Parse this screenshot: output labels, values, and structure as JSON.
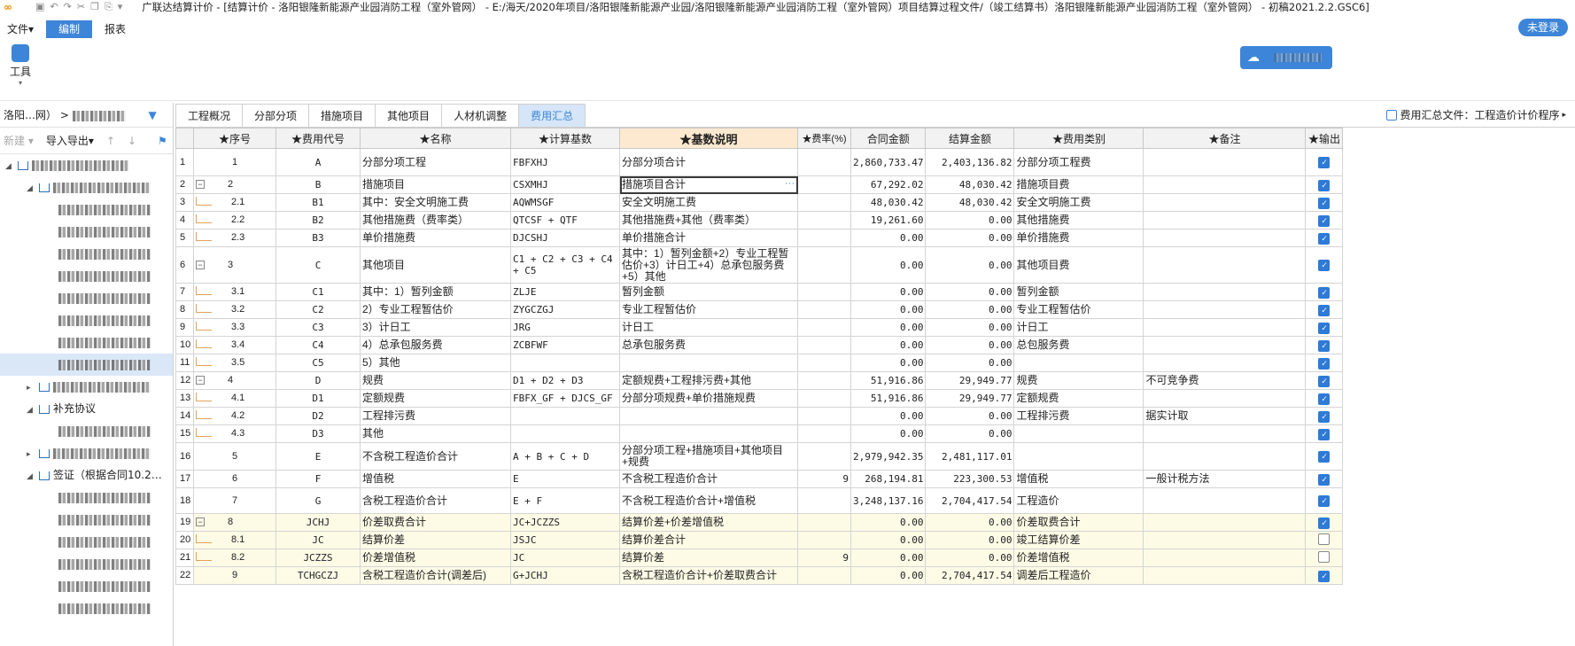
{
  "window": {
    "title": "广联达结算计价 - [结算计价 - 洛阳银隆新能源产业园消防工程（室外管网） - E:/海天/2020年项目/洛阳银隆新能源产业园/洛阳银隆新能源产业园消防工程（室外管网）项目结算过程文件/（竣工结算书）洛阳银隆新能源产业园消防工程（室外管网） - 初稿2021.2.2.GSC6]"
  },
  "menu": {
    "file": "文件▾",
    "edit": "编制",
    "report": "报表"
  },
  "login": "未登录",
  "ribbon": {
    "tool_label": "工具"
  },
  "left_panel": {
    "path": "洛阳…网）",
    "new_label": "新建 ▾",
    "import_export_label": "导入导出▾",
    "tree_items": [
      {
        "label": "洛阳银隆新能源产业园",
        "level": 0
      },
      {
        "label": "洛阳银隆新能源",
        "level": 1
      },
      {
        "label": "洛阳",
        "level": 2
      },
      {
        "label": "洛阳",
        "level": 2
      },
      {
        "label": "洛阳",
        "level": 2
      },
      {
        "label": "洛阳",
        "level": 2
      },
      {
        "label": "洛阳",
        "level": 2
      },
      {
        "label": "洛阳",
        "level": 2
      },
      {
        "label": "洛阳",
        "level": 2
      },
      {
        "label": "洛阳",
        "level": 2
      },
      {
        "label": "洛阳",
        "level": 1
      },
      {
        "label": "补充协议",
        "level": 1
      },
      {
        "label": "洛阳",
        "level": 2
      },
      {
        "label": "签证",
        "level": 1
      },
      {
        "label": "签证（根据合同10.2…",
        "level": 1
      },
      {
        "label": "洛阳",
        "level": 2
      },
      {
        "label": "洛阳",
        "level": 2
      },
      {
        "label": "洛阳",
        "level": 2
      },
      {
        "label": "洛阳",
        "level": 2
      },
      {
        "label": "洛阳",
        "level": 2
      },
      {
        "label": "洛阳",
        "level": 2
      }
    ]
  },
  "tabs": [
    "工程概况",
    "分部分项",
    "措施项目",
    "其他项目",
    "人材机调整",
    "费用汇总"
  ],
  "tab_right": "费用汇总文件：工程造价计价程序",
  "table": {
    "headers": [
      "",
      "★序号",
      "★费用代号",
      "★名称",
      "★计算基数",
      "★基数说明",
      "★费率(%)",
      "合同金额",
      "结算金额",
      "★费用类别",
      "★备注",
      "★输出"
    ],
    "rows": [
      {
        "n": "1",
        "seq": "1",
        "code": "A",
        "name": "分部分项工程",
        "base": "FBFXHJ",
        "desc": "分部分项合计",
        "rate": "",
        "contract": "2,860,733.47",
        "settle": "2,403,136.82",
        "cat": "分部分项工程费",
        "note": "",
        "out": true,
        "h": 31,
        "lvl": 0
      },
      {
        "n": "2",
        "seq": "2",
        "code": "B",
        "name": "措施项目",
        "base": "CSXMHJ",
        "desc": "措施项目合计",
        "rate": "",
        "contract": "67,292.02",
        "settle": "48,030.42",
        "cat": "措施项目费",
        "note": "",
        "out": true,
        "h": 20,
        "lvl": 0,
        "group": true,
        "editing": true
      },
      {
        "n": "3",
        "seq": "2.1",
        "code": "B1",
        "name": "其中：安全文明施工费",
        "base": "AQWMSGF",
        "desc": "安全文明施工费",
        "rate": "",
        "contract": "48,030.42",
        "settle": "48,030.42",
        "cat": "安全文明施工费",
        "note": "",
        "out": true,
        "h": 20,
        "lvl": 1
      },
      {
        "n": "4",
        "seq": "2.2",
        "code": "B2",
        "name": "其他措施费（费率类）",
        "base": "QTCSF + QTF",
        "desc": "其他措施费+其他（费率类）",
        "rate": "",
        "contract": "19,261.60",
        "settle": "0.00",
        "cat": "其他措施费",
        "note": "",
        "out": true,
        "h": 20,
        "lvl": 1
      },
      {
        "n": "5",
        "seq": "2.3",
        "code": "B3",
        "name": "单价措施费",
        "base": "DJCSHJ",
        "desc": "单价措施合计",
        "rate": "",
        "contract": "0.00",
        "settle": "0.00",
        "cat": "单价措施费",
        "note": "",
        "out": true,
        "h": 20,
        "lvl": 1
      },
      {
        "n": "6",
        "seq": "3",
        "code": "C",
        "name": "其他项目",
        "base": "C1 + C2 + C3 + C4 + C5",
        "desc": "其中：1）暂列金额+2）专业工程暂估价+3）计日工+4）总承包服务费+5）其他",
        "rate": "",
        "contract": "0.00",
        "settle": "0.00",
        "cat": "其他项目费",
        "note": "",
        "out": true,
        "h": 41,
        "lvl": 0,
        "group": true
      },
      {
        "n": "7",
        "seq": "3.1",
        "code": "C1",
        "name": "其中：1）暂列金额",
        "base": "ZLJE",
        "desc": "暂列金额",
        "rate": "",
        "contract": "0.00",
        "settle": "0.00",
        "cat": "暂列金额",
        "note": "",
        "out": true,
        "h": 20,
        "lvl": 1
      },
      {
        "n": "8",
        "seq": "3.2",
        "code": "C2",
        "name": "2）专业工程暂估价",
        "base": "ZYGCZGJ",
        "desc": "专业工程暂估价",
        "rate": "",
        "contract": "0.00",
        "settle": "0.00",
        "cat": "专业工程暂估价",
        "note": "",
        "out": true,
        "h": 20,
        "lvl": 1
      },
      {
        "n": "9",
        "seq": "3.3",
        "code": "C3",
        "name": "3）计日工",
        "base": "JRG",
        "desc": "计日工",
        "rate": "",
        "contract": "0.00",
        "settle": "0.00",
        "cat": "计日工",
        "note": "",
        "out": true,
        "h": 20,
        "lvl": 1
      },
      {
        "n": "10",
        "seq": "3.4",
        "code": "C4",
        "name": "4）总承包服务费",
        "base": "ZCBFWF",
        "desc": "总承包服务费",
        "rate": "",
        "contract": "0.00",
        "settle": "0.00",
        "cat": "总包服务费",
        "note": "",
        "out": true,
        "h": 20,
        "lvl": 1
      },
      {
        "n": "11",
        "seq": "3.5",
        "code": "C5",
        "name": "5）其他",
        "base": "",
        "desc": "",
        "rate": "",
        "contract": "0.00",
        "settle": "0.00",
        "cat": "",
        "note": "",
        "out": true,
        "h": 20,
        "lvl": 1
      },
      {
        "n": "12",
        "seq": "4",
        "code": "D",
        "name": "规费",
        "base": "D1 + D2 + D3",
        "desc": "定额规费+工程排污费+其他",
        "rate": "",
        "contract": "51,916.86",
        "settle": "29,949.77",
        "cat": "规费",
        "note": "不可竞争费",
        "out": true,
        "h": 20,
        "lvl": 0,
        "group": true
      },
      {
        "n": "13",
        "seq": "4.1",
        "code": "D1",
        "name": "定额规费",
        "base": "FBFX_GF + DJCS_GF",
        "desc": "分部分项规费+单价措施规费",
        "rate": "",
        "contract": "51,916.86",
        "settle": "29,949.77",
        "cat": "定额规费",
        "note": "",
        "out": true,
        "h": 20,
        "lvl": 1
      },
      {
        "n": "14",
        "seq": "4.2",
        "code": "D2",
        "name": "工程排污费",
        "base": "",
        "desc": "",
        "rate": "",
        "contract": "0.00",
        "settle": "0.00",
        "cat": "工程排污费",
        "note": "据实计取",
        "out": true,
        "h": 20,
        "lvl": 1
      },
      {
        "n": "15",
        "seq": "4.3",
        "code": "D3",
        "name": "其他",
        "base": "",
        "desc": "",
        "rate": "",
        "contract": "0.00",
        "settle": "0.00",
        "cat": "",
        "note": "",
        "out": true,
        "h": 20,
        "lvl": 1
      },
      {
        "n": "16",
        "seq": "5",
        "code": "E",
        "name": "不含税工程造价合计",
        "base": "A + B + C + D",
        "desc": "分部分项工程+措施项目+其他项目+规费",
        "rate": "",
        "contract": "2,979,942.35",
        "settle": "2,481,117.01",
        "cat": "",
        "note": "",
        "out": true,
        "h": 31,
        "lvl": 0
      },
      {
        "n": "17",
        "seq": "6",
        "code": "F",
        "name": "增值税",
        "base": "E",
        "desc": "不含税工程造价合计",
        "rate": "9",
        "contract": "268,194.81",
        "settle": "223,300.53",
        "cat": "增值税",
        "note": "一般计税方法",
        "out": true,
        "h": 20,
        "lvl": 0
      },
      {
        "n": "18",
        "seq": "7",
        "code": "G",
        "name": "含税工程造价合计",
        "base": "E + F",
        "desc": "不含税工程造价合计+增值税",
        "rate": "",
        "contract": "3,248,137.16",
        "settle": "2,704,417.54",
        "cat": "工程造价",
        "note": "",
        "out": true,
        "h": 29,
        "lvl": 0
      },
      {
        "n": "19",
        "seq": "8",
        "code": "JCHJ",
        "name": "价差取费合计",
        "base": "JC+JCZZS",
        "desc": "结算价差+价差增值税",
        "rate": "",
        "contract": "0.00",
        "settle": "0.00",
        "cat": "价差取费合计",
        "note": "",
        "out": true,
        "h": 20,
        "lvl": 0,
        "group": true,
        "yellow": true
      },
      {
        "n": "20",
        "seq": "8.1",
        "code": "JC",
        "name": "结算价差",
        "base": "JSJC",
        "desc": "结算价差合计",
        "rate": "",
        "contract": "0.00",
        "settle": "0.00",
        "cat": "竣工结算价差",
        "note": "",
        "out": false,
        "h": 20,
        "lvl": 1,
        "yellow": true
      },
      {
        "n": "21",
        "seq": "8.2",
        "code": "JCZZS",
        "name": "价差增值税",
        "base": "JC",
        "desc": "结算价差",
        "rate": "9",
        "contract": "0.00",
        "settle": "0.00",
        "cat": "价差增值税",
        "note": "",
        "out": false,
        "h": 20,
        "lvl": 1,
        "yellow": true
      },
      {
        "n": "22",
        "seq": "9",
        "code": "TCHGCZJ",
        "name": "含税工程造价合计(调差后)",
        "base": "G+JCHJ",
        "desc": "含税工程造价合计+价差取费合计",
        "rate": "",
        "contract": "0.00",
        "settle": "2,704,417.54",
        "cat": "调差后工程造价",
        "note": "",
        "out": true,
        "h": 20,
        "lvl": 0,
        "yellow": true
      }
    ]
  }
}
